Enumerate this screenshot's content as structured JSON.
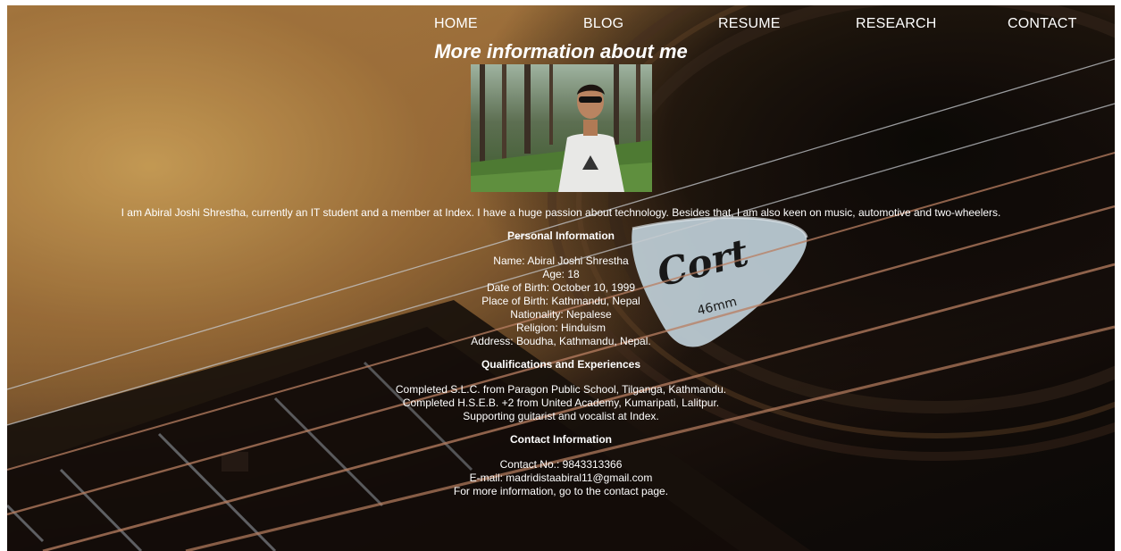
{
  "nav": {
    "items": [
      {
        "label": "HOME"
      },
      {
        "label": "BLOG"
      },
      {
        "label": "RESUME"
      },
      {
        "label": "RESEARCH"
      },
      {
        "label": "CONTACT"
      }
    ]
  },
  "page": {
    "title": "More information about me",
    "intro": "I am Abiral Joshi Shrestha, currently an IT student and a member at Index. I have a huge passion about technology. Besides that, I am also keen on music, automotive and two-wheelers."
  },
  "background": {
    "pick_brand": "Cort",
    "pick_size": "46mm"
  },
  "personal": {
    "heading": "Personal Information",
    "lines": [
      "Name: Abiral Joshi Shrestha",
      "Age: 18",
      "Date of Birth: October 10, 1999",
      "Place of Birth: Kathmandu, Nepal",
      "Nationality: Nepalese",
      "Religion: Hinduism",
      "Address: Boudha, Kathmandu, Nepal."
    ]
  },
  "qualifications": {
    "heading": "Qualifications and Experiences",
    "lines": [
      "Completed S.L.C. from Paragon Public School, Tilganga, Kathmandu.",
      "Completed H.S.E.B. +2 from United Academy, Kumaripati, Lalitpur.",
      "Supporting guitarist and vocalist at Index."
    ]
  },
  "contact": {
    "heading": "Contact Information",
    "lines": [
      "Contact No.: 9843313366",
      "E-mail: madridistaabiral11@gmail.com",
      "For more information, go to the contact page."
    ]
  },
  "colors": {
    "text": "#ffffff",
    "wood": "#c99a5a",
    "soundhole": "#0c0908",
    "string": "#c98a6a"
  }
}
